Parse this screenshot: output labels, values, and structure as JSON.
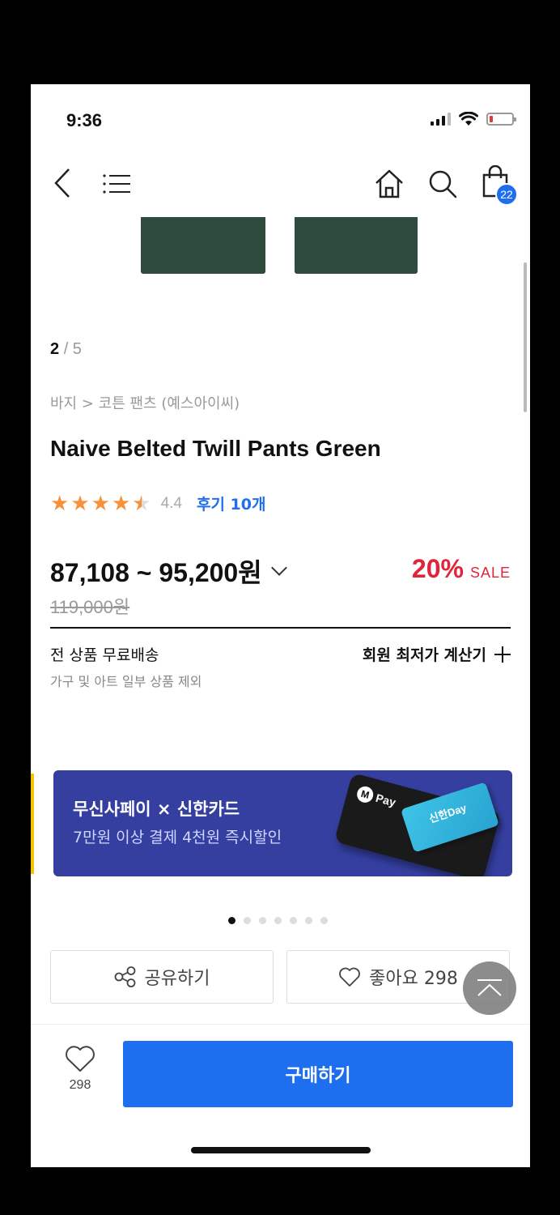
{
  "status_bar": {
    "time": "9:36"
  },
  "nav": {
    "cart_count": "22"
  },
  "gallery": {
    "current": "2",
    "total": "/ 5"
  },
  "product": {
    "breadcrumb": "바지 > 코튼 팬츠 (예스아이씨)",
    "title": "Naive Belted Twill Pants Green",
    "rating": 4.4,
    "rating_text": "4.4",
    "review_link": "후기 10개",
    "price_range": "87,108 ~ 95,200원",
    "discount_percent": "20%",
    "sale_label": "SALE",
    "original_price": "119,000원"
  },
  "shipping": {
    "title": "전 상품 무료배송",
    "note": "가구 및 아트 일부 상품 제외",
    "calc_link": "회원 최저가 계산기"
  },
  "banner": {
    "title": "무신사페이 × 신한카드",
    "subtitle": "7만원 이상 결제 4천원 즉시할인",
    "phone_label": "Pay",
    "card_label": "신한Day",
    "slide_count": 7,
    "active_slide": 1
  },
  "actions": {
    "share_label": "공유하기",
    "like_label": "좋아요 298"
  },
  "bottom_bar": {
    "wish_count": "298",
    "buy_label": "구매하기"
  },
  "colors": {
    "accent": "#1e6ff0",
    "sale": "#e0243a",
    "star": "#f7923a",
    "banner": "#343fa0"
  }
}
